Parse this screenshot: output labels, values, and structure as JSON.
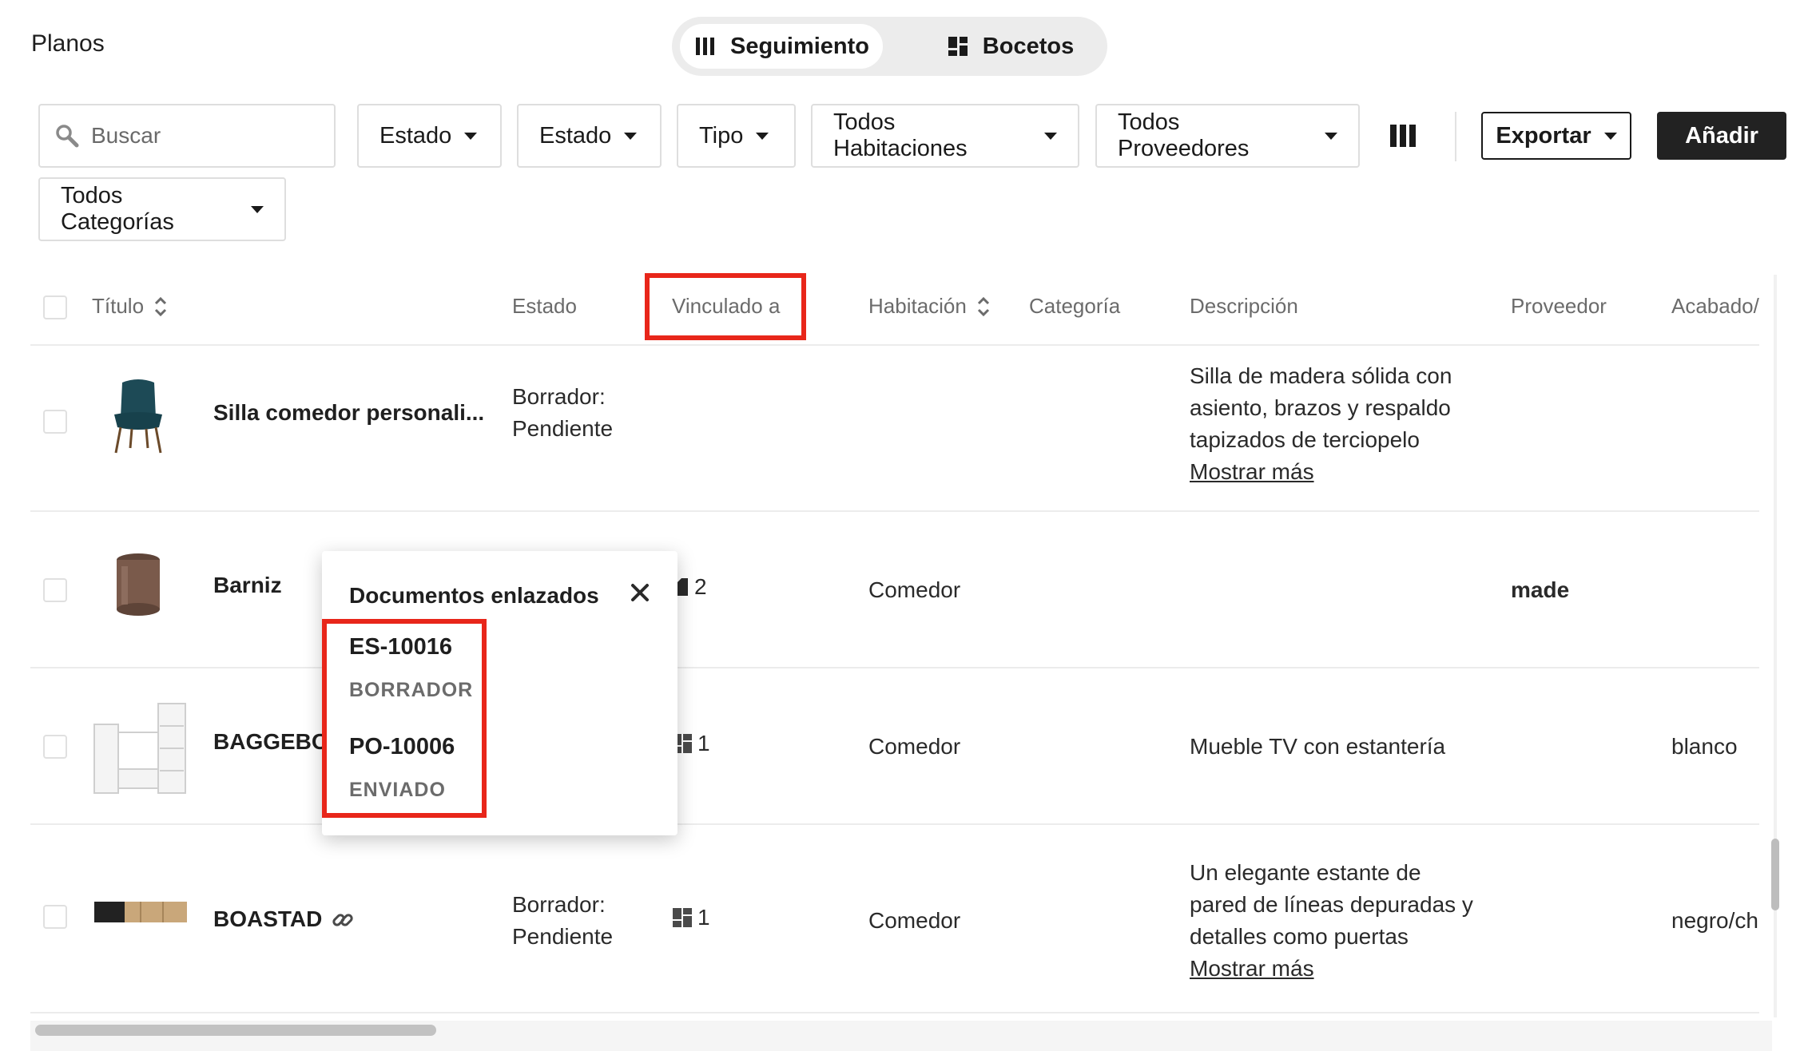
{
  "page": {
    "title": "Planos"
  },
  "view_toggle": {
    "tracking_label": "Seguimiento",
    "sketches_label": "Bocetos"
  },
  "toolbar": {
    "search_placeholder": "Buscar",
    "filters": [
      "Estado",
      "Estado",
      "Tipo",
      "Todos Habitaciones",
      "Todos Proveedores",
      "Todos Categorías"
    ],
    "export_label": "Exportar",
    "add_label": "Añadir"
  },
  "table": {
    "headers": {
      "title": "Título",
      "status": "Estado",
      "linked": "Vinculado a",
      "room": "Habitación",
      "category": "Categoría",
      "description": "Descripción",
      "supplier": "Proveedor",
      "finish": "Acabado/"
    },
    "rows": [
      {
        "title": "Silla comedor personali...",
        "status_line1": "Borrador:",
        "status_line2": "Pendiente",
        "linked_count": "",
        "room": "",
        "description_lines": [
          "Silla de madera sólida con",
          "asiento, brazos y respaldo",
          "tapizados de terciopelo"
        ],
        "show_more": "Mostrar más",
        "supplier": "",
        "finish": ""
      },
      {
        "title": "Barniz",
        "status_line1": "",
        "status_line2": "",
        "linked_count": "2",
        "room": "Comedor",
        "description_lines": [],
        "show_more": "",
        "supplier": "made",
        "finish": ""
      },
      {
        "title": "BAGGEBO",
        "status_line1": "",
        "status_line2": "",
        "linked_count": "1",
        "room": "Comedor",
        "description_lines": [
          "Mueble TV con estantería"
        ],
        "show_more": "",
        "supplier": "",
        "finish": "blanco"
      },
      {
        "title": "BOASTAD",
        "status_line1": "Borrador:",
        "status_line2": "Pendiente",
        "linked_count": "1",
        "room": "Comedor",
        "description_lines": [
          "Un elegante estante de",
          "pared de líneas depuradas y",
          "detalles como puertas"
        ],
        "show_more": "Mostrar más",
        "supplier": "",
        "finish": "negro/ch"
      }
    ]
  },
  "popover": {
    "title": "Documentos enlazados",
    "documents": [
      {
        "code": "ES-10016",
        "status": "BORRADOR"
      },
      {
        "code": "PO-10006",
        "status": "ENVIADO"
      }
    ]
  },
  "colors": {
    "highlight": "#e8261a",
    "primary_button": "#222222",
    "border": "#dedede"
  }
}
